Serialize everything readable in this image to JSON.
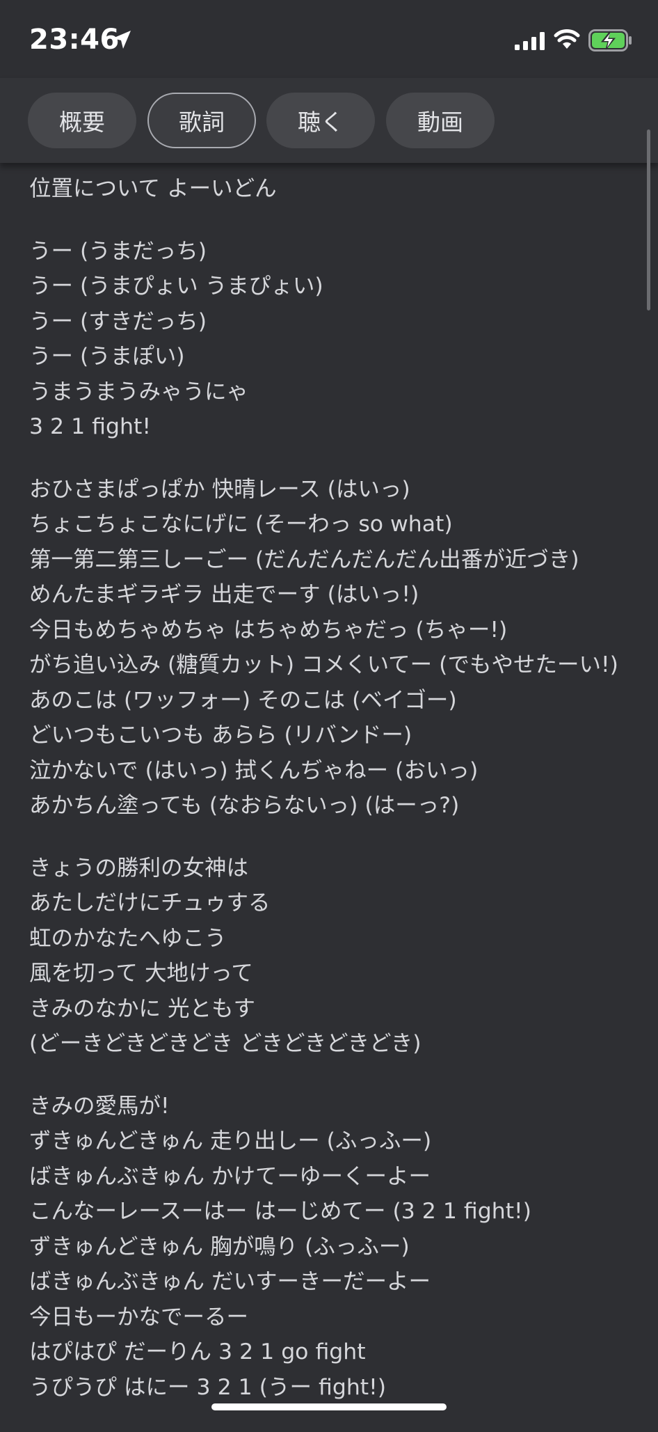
{
  "status_bar": {
    "time": "23:46"
  },
  "tabs": [
    {
      "label": "概要"
    },
    {
      "label": "歌詞"
    },
    {
      "label": "聴く"
    },
    {
      "label": "動画"
    }
  ],
  "lyrics": {
    "stanzas": [
      [
        "位置について よーいどん"
      ],
      [
        "うー (うまだっち)",
        "うー (うまぴょい うまぴょい)",
        "うー (すきだっち)",
        "うー (うまぽい)",
        "うまうまうみゃうにゃ",
        "3 2 1 fight!"
      ],
      [
        "おひさまぱっぱか 快晴レース (はいっ)",
        "ちょこちょこなにげに (そーわっ so what)",
        "第一第二第三しーごー (だんだんだんだん出番が近づき)",
        "めんたまギラギラ 出走でーす (はいっ!)",
        "今日もめちゃめちゃ はちゃめちゃだっ (ちゃー!)",
        "がち追い込み (糖質カット) コメくいてー (でもやせたーい!)",
        "あのこは (ワッフォー) そのこは (ベイゴー)",
        "どいつもこいつも あらら (リバンドー)",
        "泣かないで (はいっ) 拭くんぢゃねー (おいっ)",
        "あかちん塗っても (なおらないっ) (はーっ?)"
      ],
      [
        "きょうの勝利の女神は",
        "あたしだけにチュゥする",
        "虹のかなたへゆこう",
        "風を切って 大地けって",
        "きみのなかに 光ともす",
        "(どーきどきどきどき どきどきどきどき)"
      ],
      [
        "きみの愛馬が!",
        "ずきゅんどきゅん 走り出しー (ふっふー)",
        "ばきゅんぶきゅん かけてーゆーくーよー",
        "こんなーレースーはー はーじめてー (3 2 1 fight!)",
        "ずきゅんどきゅん 胸が鳴り (ふっふー)",
        "ばきゅんぶきゅん だいすーきーだーよー",
        "今日もーかなでーるー",
        "はぴはぴ だーりん 3 2 1 go fight",
        "うぴうぴ はにー 3 2 1 (うー fight!)"
      ]
    ]
  }
}
